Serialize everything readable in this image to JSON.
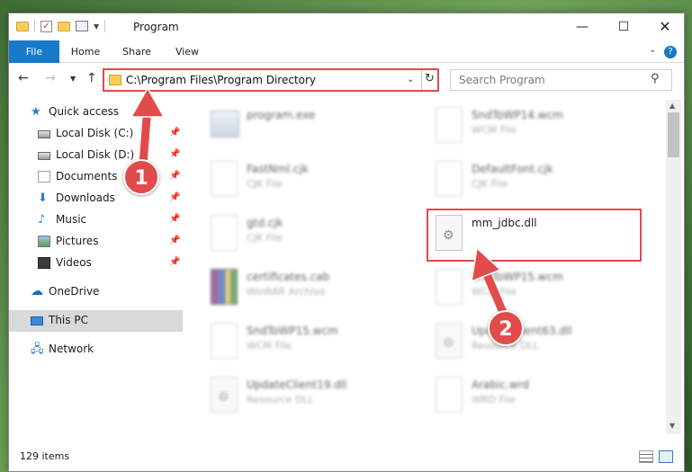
{
  "window": {
    "title": "Program",
    "minimize": "—",
    "maximize": "☐",
    "close": "✕"
  },
  "ribbon": {
    "tabs": [
      "File",
      "Home",
      "Share",
      "View"
    ],
    "help": "?"
  },
  "address_bar": {
    "path": "C:\\Program Files\\Program Directory"
  },
  "search": {
    "placeholder": "Search Program"
  },
  "sidebar": {
    "items": [
      {
        "label": "Quick access",
        "icon": "star-icon"
      },
      {
        "label": "Local Disk (C:)",
        "icon": "drive-icon",
        "pinned": true
      },
      {
        "label": "Local Disk (D:)",
        "icon": "drive-icon",
        "pinned": true
      },
      {
        "label": "Documents",
        "icon": "documents-icon",
        "pinned": true
      },
      {
        "label": "Downloads",
        "icon": "download-icon",
        "pinned": true
      },
      {
        "label": "Music",
        "icon": "music-icon",
        "pinned": true
      },
      {
        "label": "Pictures",
        "icon": "pictures-icon",
        "pinned": true
      },
      {
        "label": "Videos",
        "icon": "video-icon",
        "pinned": true
      },
      {
        "label": "OneDrive",
        "icon": "cloud-icon"
      },
      {
        "label": "This PC",
        "icon": "computer-icon",
        "selected": true
      },
      {
        "label": "Network",
        "icon": "network-icon"
      }
    ]
  },
  "files": [
    {
      "name": "program.exe",
      "type": "",
      "icon": "exe-icon"
    },
    {
      "name": "SndToWP14.wcm",
      "type": "WCM File",
      "icon": "file-icon"
    },
    {
      "name": "FastNml.cjk",
      "type": "CJK File",
      "icon": "file-icon"
    },
    {
      "name": "DefaultFont.cjk",
      "type": "CJK File",
      "icon": "file-icon"
    },
    {
      "name": "gtd.cjk",
      "type": "CJK File",
      "icon": "file-icon"
    },
    {
      "name": "mm_jdbc.dll",
      "type": "",
      "icon": "dll-icon"
    },
    {
      "name": "certificates.cab",
      "type": "WinRAR Archive",
      "icon": "winrar-icon"
    },
    {
      "name": "SndToWP15.wcm",
      "type": "WCM File",
      "icon": "file-icon"
    },
    {
      "name": "SndToWP15.wcm",
      "type": "WCM File",
      "icon": "file-icon"
    },
    {
      "name": "UpdateClient63.dll",
      "type": "Resource DLL",
      "icon": "dll-icon"
    },
    {
      "name": "UpdateClient19.dll",
      "type": "Resource DLL",
      "icon": "dll-icon"
    },
    {
      "name": "Arabic.wrd",
      "type": "WRD File",
      "icon": "file-icon"
    }
  ],
  "annotations": {
    "step1": "1",
    "step2": "2",
    "color": "#e24b4b"
  },
  "status": {
    "item_count": "129 items"
  }
}
